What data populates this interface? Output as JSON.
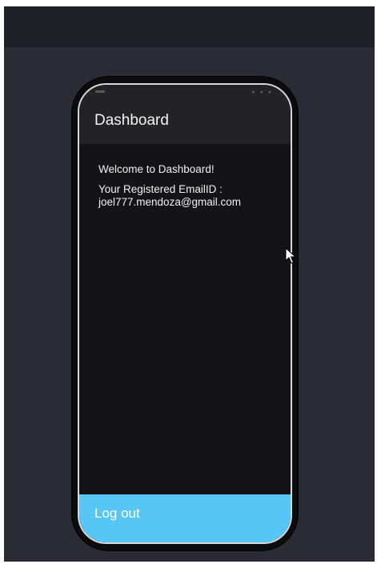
{
  "header": {
    "title": "Dashboard"
  },
  "content": {
    "welcome": "Welcome to Dashboard!",
    "email_label": "Your Registered EmailID :",
    "email_value": "joel777.mendoza@gmail.com"
  },
  "actions": {
    "logout_label": "Log out"
  },
  "status": {
    "indicators": "● ● ●"
  },
  "colors": {
    "page_bg": "#2a2b35",
    "topbar_bg": "#1e1f27",
    "phone_screen_bg": "#141416",
    "header_bg": "#232325",
    "logout_bg": "#56c7f5"
  },
  "icons": {
    "cursor": "mouse-pointer-icon"
  }
}
